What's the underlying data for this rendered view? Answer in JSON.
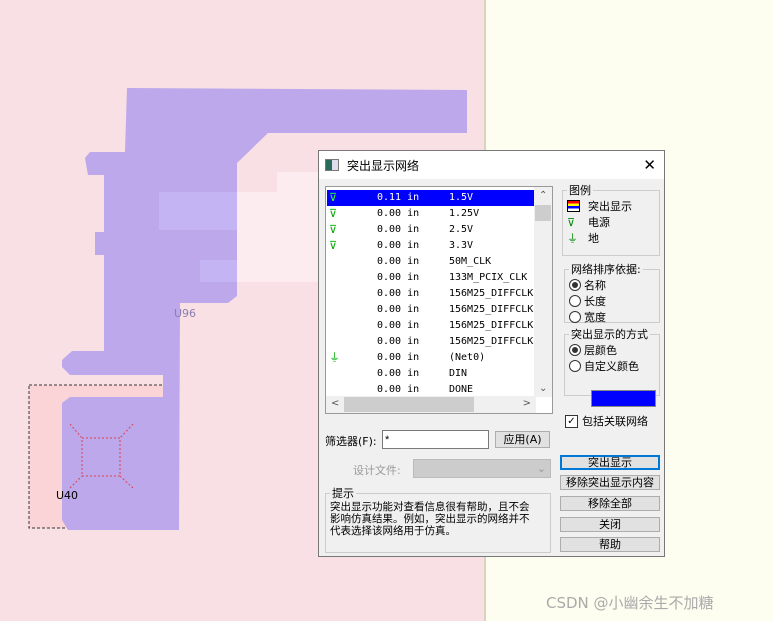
{
  "canvas": {
    "labels": [
      "U96",
      "U40"
    ]
  },
  "dialog": {
    "title": "突出显示网络",
    "nets": [
      {
        "icon": "power",
        "length": "0.11 in",
        "name": "1.5V",
        "selected": true
      },
      {
        "icon": "power",
        "length": "0.00 in",
        "name": "1.25V"
      },
      {
        "icon": "power",
        "length": "0.00 in",
        "name": "2.5V"
      },
      {
        "icon": "power",
        "length": "0.00 in",
        "name": "3.3V"
      },
      {
        "icon": "",
        "length": "0.00 in",
        "name": "50M_CLK"
      },
      {
        "icon": "",
        "length": "0.00 in",
        "name": "133M_PCIX_CLK"
      },
      {
        "icon": "",
        "length": "0.00 in",
        "name": "156M25_DIFFCLK"
      },
      {
        "icon": "",
        "length": "0.00 in",
        "name": "156M25_DIFFCLK"
      },
      {
        "icon": "",
        "length": "0.00 in",
        "name": "156M25_DIFFCLK"
      },
      {
        "icon": "",
        "length": "0.00 in",
        "name": "156M25_DIFFCLK"
      },
      {
        "icon": "ground",
        "length": "0.00 in",
        "name": "(Net0)"
      },
      {
        "icon": "",
        "length": "0.00 in",
        "name": "DIN"
      },
      {
        "icon": "",
        "length": "0.00 in",
        "name": "DONE"
      }
    ],
    "legend": {
      "title": "图例",
      "items": [
        "突出显示",
        "电源",
        "地"
      ]
    },
    "sort": {
      "title": "网络排序依据:",
      "options": [
        "名称",
        "长度",
        "宽度"
      ],
      "selected": 0
    },
    "mode": {
      "title": "突出显示的方式",
      "options": [
        "层颜色",
        "自定义颜色"
      ],
      "selected": 0,
      "custom_color": "#0000ff"
    },
    "include_related": {
      "label": "包括关联网络",
      "checked": true
    },
    "filter": {
      "label": "筛选器(F):",
      "value": "*",
      "apply": "应用(A)"
    },
    "design_file": {
      "label": "设计文件:",
      "value": ""
    },
    "hint": {
      "title": "提示",
      "text": "突出显示功能对查看信息很有帮助，且不会影响仿真结果。例如，突出显示的网络并不代表选择该网络用于仿真。"
    },
    "buttons": [
      "突出显示",
      "移除突出显示内容",
      "移除全部",
      "关闭",
      "帮助"
    ]
  },
  "watermark": "CSDN @小幽余生不加糖"
}
